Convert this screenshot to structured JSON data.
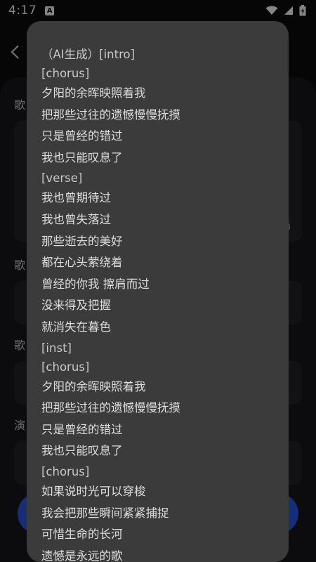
{
  "status_bar": {
    "time": "4:17",
    "app_icon": "A"
  },
  "background": {
    "labels": [
      "歌",
      "歌",
      "歌",
      "演"
    ],
    "fragment": "0"
  },
  "lyrics_popup": {
    "lines": [
      {
        "text": "（AI生成）[intro]",
        "tag": true
      },
      {
        "text": "[chorus]",
        "tag": true
      },
      {
        "text": "夕阳的余晖映照着我",
        "tag": false
      },
      {
        "text": "把那些过往的遗憾慢慢抚摸",
        "tag": false
      },
      {
        "text": "只是曾经的错过",
        "tag": false
      },
      {
        "text": "我也只能叹息了",
        "tag": false
      },
      {
        "text": "[verse]",
        "tag": true
      },
      {
        "text": "我也曾期待过",
        "tag": false
      },
      {
        "text": "我也曾失落过",
        "tag": false
      },
      {
        "text": "那些逝去的美好",
        "tag": false
      },
      {
        "text": "都在心头萦绕着",
        "tag": false
      },
      {
        "text": "曾经的你我 擦肩而过",
        "tag": false
      },
      {
        "text": "没来得及把握",
        "tag": false
      },
      {
        "text": "就消失在暮色",
        "tag": false
      },
      {
        "text": "[inst]",
        "tag": true
      },
      {
        "text": "[chorus]",
        "tag": true
      },
      {
        "text": "夕阳的余晖映照着我",
        "tag": false
      },
      {
        "text": "把那些过往的遗憾慢慢抚摸",
        "tag": false
      },
      {
        "text": "只是曾经的错过",
        "tag": false
      },
      {
        "text": "我也只能叹息了",
        "tag": false
      },
      {
        "text": "[chorus]",
        "tag": true
      },
      {
        "text": "如果说时光可以穿梭",
        "tag": false
      },
      {
        "text": "我会把那些瞬间紧紧捕捉",
        "tag": false
      },
      {
        "text": "可惜生命的长河",
        "tag": false
      },
      {
        "text": "遗憾是永远的歌",
        "tag": false
      }
    ]
  }
}
